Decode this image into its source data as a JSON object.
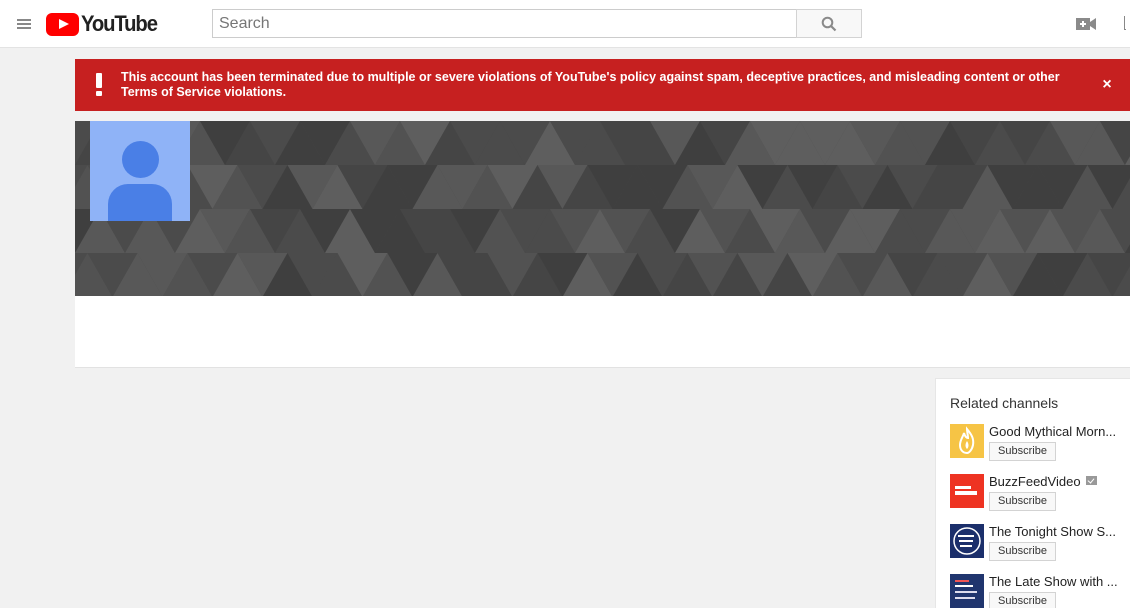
{
  "masthead": {
    "logo_text": "YouTube",
    "search_placeholder": "Search"
  },
  "alert": {
    "message": "This account has been terminated due to multiple or severe violations of YouTube's policy against spam, deceptive practices, and misleading content or other Terms of Service violations.",
    "close_symbol": "×"
  },
  "related": {
    "title": "Related channels",
    "subscribe_label": "Subscribe",
    "channels": [
      {
        "name": "Good Mythical Morn...",
        "verified": false
      },
      {
        "name": "BuzzFeedVideo",
        "verified": true
      },
      {
        "name": "The Tonight Show S...",
        "verified": false
      },
      {
        "name": "The Late Show with ...",
        "verified": false
      }
    ]
  },
  "colors": {
    "alert_bg": "#c62020",
    "logo_red": "#ff0000",
    "avatar_bg": "#8fb3f7",
    "avatar_fg": "#4a7fe6",
    "banner_bg": "#4b4b4b"
  }
}
